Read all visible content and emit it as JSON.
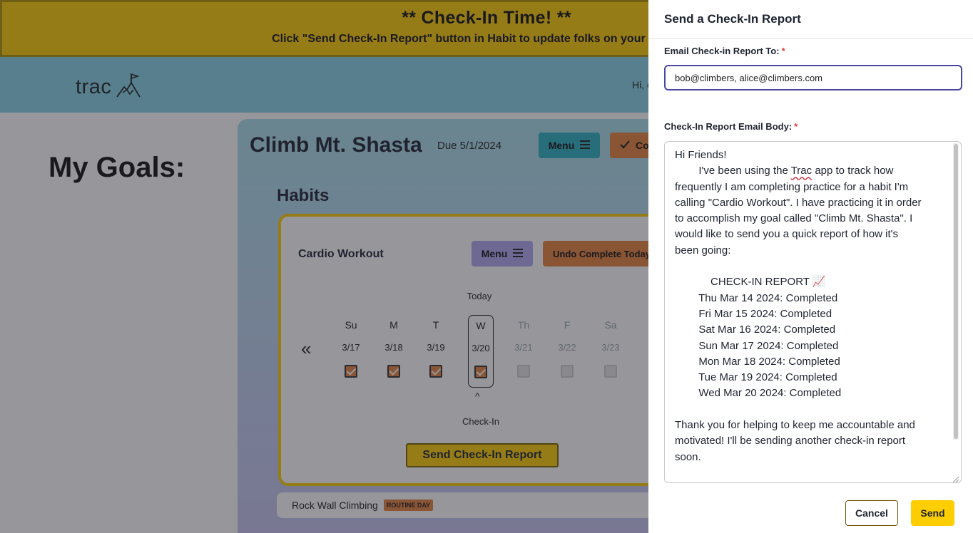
{
  "banner": {
    "title": "** Check-In Time! **",
    "subtitle": "Click \"Send Check-In Report\" button in Habit to update folks on your progress!"
  },
  "nav": {
    "logo_text": "trac",
    "logo_icon": "mountain-flag-icon",
    "greeting": "Hi, climber!"
  },
  "page": {
    "heading": "My Goals:"
  },
  "goal": {
    "title": "Climb Mt. Shasta",
    "due": "Due 5/1/2024",
    "menu_label": "Menu",
    "complete_label": "Complete",
    "habits_heading": "Habits"
  },
  "habit": {
    "name": "Cardio Workout",
    "menu_label": "Menu",
    "undo_label": "Undo Complete Today",
    "today_label": "Today",
    "prev_week_glyph": "«",
    "caret_glyph": "^",
    "checkin_label": "Check-In",
    "send_report_label": "Send Check-In Report",
    "days": [
      {
        "letter": "Su",
        "date": "3/17",
        "completed": true
      },
      {
        "letter": "M",
        "date": "3/18",
        "completed": true
      },
      {
        "letter": "T",
        "date": "3/19",
        "completed": true
      },
      {
        "letter": "W",
        "date": "3/20",
        "completed": true
      },
      {
        "letter": "Th",
        "date": "3/21",
        "completed": false
      },
      {
        "letter": "F",
        "date": "3/22",
        "completed": false
      },
      {
        "letter": "Sa",
        "date": "3/23",
        "completed": false
      }
    ]
  },
  "routine": {
    "name": "Rock Wall Climbing",
    "badge": "ROUTINE DAY"
  },
  "drawer": {
    "title": "Send a Check-In Report",
    "email_label": "Email Check-in Report To:",
    "required_mark": "*",
    "email_value": "bob@climbers, alice@climbers.com",
    "body_label": "Check-In Report Email Body:",
    "body_lines": {
      "l1": "Hi Friends!",
      "l2a": "        I've been using the ",
      "l2_app": "Trac",
      "l2b": " app to track how",
      "l3": "frequently I am completing practice for a habit I'm",
      "l4": "calling \"Cardio Workout\". I have practicing it in order",
      "l5": "to accomplish my goal called \"Climb Mt. Shasta\". I",
      "l6": "would like to send you a quick report of how it's",
      "l7": "been going:",
      "l8": " ",
      "l9": "            CHECK-IN REPORT 📈",
      "l10": "        Thu Mar 14 2024: Completed",
      "l11": "        Fri Mar 15 2024: Completed",
      "l12": "        Sat Mar 16 2024: Completed",
      "l13": "        Sun Mar 17 2024: Completed",
      "l14": "        Mon Mar 18 2024: Completed",
      "l15": "        Tue Mar 19 2024: Completed",
      "l16": "        Wed Mar 20 2024: Completed",
      "l17": " ",
      "l18": "Thank you for helping to keep me accountable and",
      "l19": "motivated! I'll be sending another check-in report",
      "l20": "soon."
    },
    "cancel_label": "Cancel",
    "send_label": "Send"
  },
  "colors": {
    "accent_yellow": "#FFCE00",
    "accent_orange": "#E8833A",
    "accent_teal": "#2CB1C0",
    "accent_purple": "#B3A9F0",
    "nav_blue": "#86D3E4",
    "focus_border": "#4a47a3"
  }
}
